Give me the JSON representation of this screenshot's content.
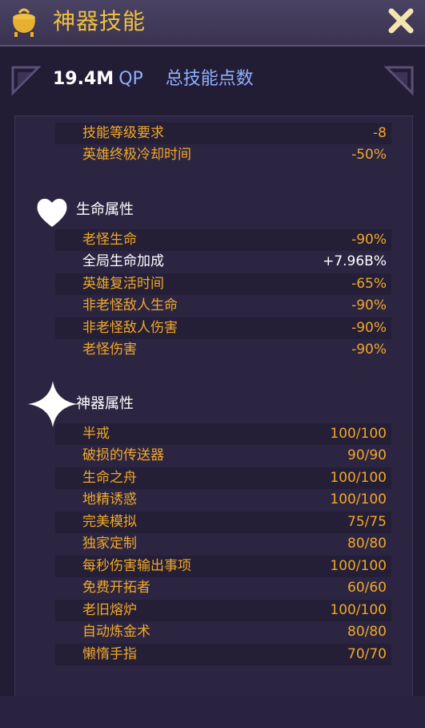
{
  "title": "神器技能",
  "header": {
    "qp_value": "19.4M",
    "qp_unit": "QP",
    "qp_label": "总技能点数"
  },
  "top_rows": [
    {
      "name": "技能等级要求",
      "value": "-8"
    },
    {
      "name": "英雄终极冷却时间",
      "value": "-50%"
    }
  ],
  "life_section": {
    "heading": "生命属性",
    "rows": [
      {
        "name": "老怪生命",
        "value": "-90%"
      },
      {
        "name": "全局生命加成",
        "value": "+7.96B%"
      },
      {
        "name": "英雄复活时间",
        "value": "-65%"
      },
      {
        "name": "非老怪敌人生命",
        "value": "-90%"
      },
      {
        "name": "非老怪敌人伤害",
        "value": "-90%"
      },
      {
        "name": "老怪伤害",
        "value": "-90%"
      }
    ]
  },
  "artifact_section": {
    "heading": "神器属性",
    "rows": [
      {
        "name": "半戒",
        "value": "100/100"
      },
      {
        "name": "破损的传送器",
        "value": "90/90"
      },
      {
        "name": "生命之舟",
        "value": "100/100"
      },
      {
        "name": "地精诱惑",
        "value": "100/100"
      },
      {
        "name": "完美模拟",
        "value": "75/75"
      },
      {
        "name": "独家定制",
        "value": "80/80"
      },
      {
        "name": "每秒伤害输出事项",
        "value": "100/100"
      },
      {
        "name": "免费开拓者",
        "value": "60/60"
      },
      {
        "name": "老旧熔炉",
        "value": "100/100"
      },
      {
        "name": "自动炼金术",
        "value": "80/80"
      },
      {
        "name": "懒惰手指",
        "value": "70/70"
      }
    ]
  },
  "colors": {
    "gold": "#f0a828",
    "title_gold": "#f0c040",
    "qp_blue": "#8fb0ff"
  },
  "icons": {
    "title": "cauldron-icon",
    "close": "close-icon",
    "life": "heart-icon",
    "artifact": "sparkle-icon"
  }
}
